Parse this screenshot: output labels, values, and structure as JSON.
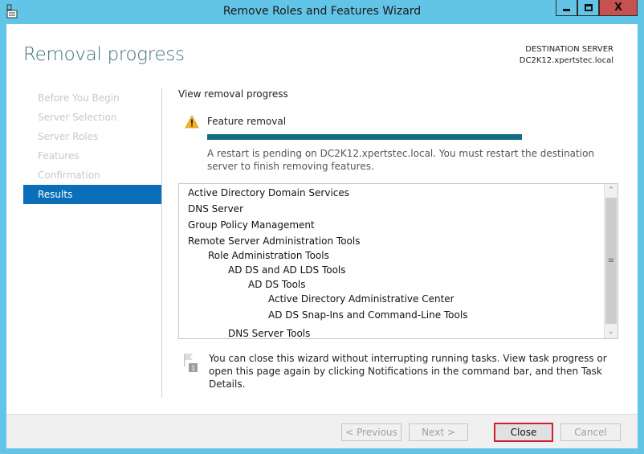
{
  "window": {
    "title": "Remove Roles and Features Wizard",
    "close_glyph": "X"
  },
  "header": {
    "page_title": "Removal progress",
    "destination_label": "DESTINATION SERVER",
    "destination_server": "DC2K12.xpertstec.local"
  },
  "sidebar": {
    "items": [
      {
        "label": "Before You Begin",
        "active": false
      },
      {
        "label": "Server Selection",
        "active": false
      },
      {
        "label": "Server Roles",
        "active": false
      },
      {
        "label": "Features",
        "active": false
      },
      {
        "label": "Confirmation",
        "active": false
      },
      {
        "label": "Results",
        "active": true
      }
    ]
  },
  "content": {
    "section_label": "View removal progress",
    "feature_label": "Feature removal",
    "progress_percent": 100,
    "restart_message": "A restart is pending on DC2K12.xpertstec.local. You must restart the destination server to finish removing features.",
    "removed_items": [
      {
        "label": "Active Directory Domain Services",
        "level": 0
      },
      {
        "label": "DNS Server",
        "level": 0
      },
      {
        "label": "Group Policy Management",
        "level": 0
      },
      {
        "label": "Remote Server Administration Tools",
        "level": 0
      },
      {
        "label": "Role Administration Tools",
        "level": 1
      },
      {
        "label": "AD DS and AD LDS Tools",
        "level": 2
      },
      {
        "label": "AD DS Tools",
        "level": 3
      },
      {
        "label": "Active Directory Administrative Center",
        "level": 4
      },
      {
        "label": "AD DS Snap-Ins and Command-Line Tools",
        "level": 4
      },
      {
        "label": "DNS Server Tools",
        "level": 2
      }
    ],
    "info_message": "You can close this wizard without interrupting running tasks. View task progress or open this page again by clicking Notifications in the command bar, and then Task Details.",
    "flag_badge": "1"
  },
  "footer": {
    "previous_label": "< Previous",
    "next_label": "Next >",
    "close_label": "Close",
    "cancel_label": "Cancel"
  },
  "colors": {
    "titlebar": "#62c4e6",
    "accent": "#0a6fb8",
    "progress": "#136d84",
    "highlight_border": "#d0202e"
  }
}
